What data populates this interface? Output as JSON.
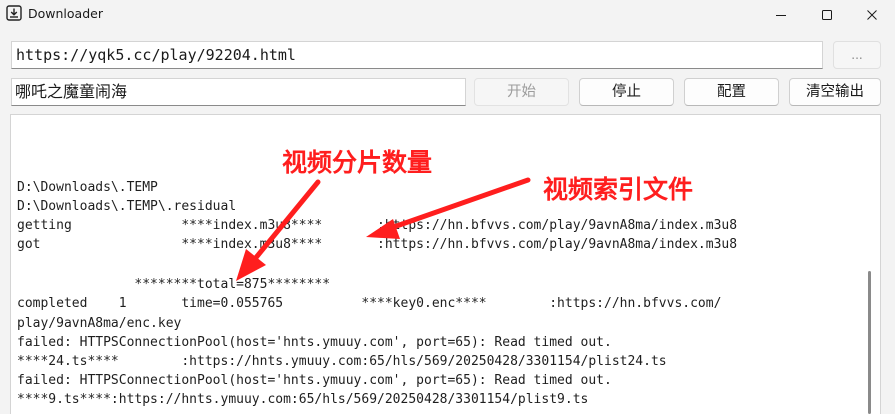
{
  "window": {
    "title": "Downloader"
  },
  "url_field": {
    "value": "https://yqk5.cc/play/92204.html"
  },
  "browse_button": {
    "label": "..."
  },
  "name_field": {
    "value": "哪吒之魔童闹海"
  },
  "buttons": {
    "start": "开始",
    "stop": "停止",
    "config": "配置",
    "clear": "清空输出"
  },
  "log": {
    "lines": [
      "D:\\Downloads\\.TEMP",
      "D:\\Downloads\\.TEMP\\.residual",
      "getting              ****index.m3u8****       :https://hn.bfvvs.com/play/9avnA8ma/index.m3u8",
      "got                  ****index.m3u8****       :https://hn.bfvvs.com/play/9avnA8ma/index.m3u8",
      "",
      "               ********total=875********",
      "completed    1       time=0.055765          ****key0.enc****        :https://hn.bfvvs.com/",
      "play/9avnA8ma/enc.key",
      "failed: HTTPSConnectionPool(host='hnts.ymuuy.com', port=65): Read timed out.",
      "****24.ts****        :https://hnts.ymuuy.com:65/hls/569/20250428/3301154/plist24.ts",
      "failed: HTTPSConnectionPool(host='hnts.ymuuy.com', port=65): Read timed out.",
      "****9.ts****:https://hnts.ymuuy.com:65/hls/569/20250428/3301154/plist9.ts"
    ]
  },
  "annotations": {
    "segments": "视频分片数量",
    "index_file": "视频索引文件"
  },
  "colors": {
    "annotation": "#ff1e1e"
  }
}
